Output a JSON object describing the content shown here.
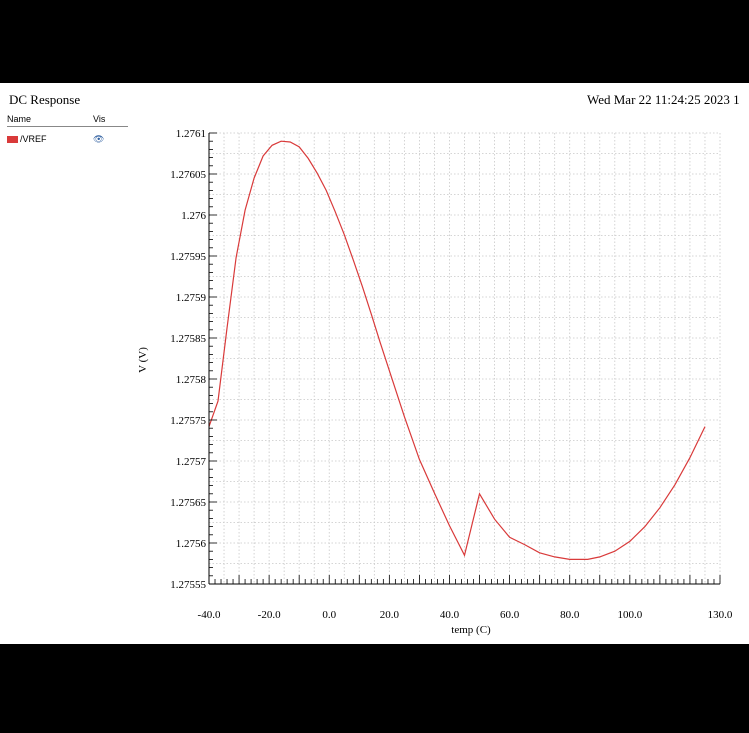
{
  "header": {
    "title": "DC Response",
    "timestamp": "Wed Mar 22 11:24:25 2023  1"
  },
  "legend": {
    "name_header": "Name",
    "vis_header": "Vis",
    "signals": [
      {
        "name": "/VREF",
        "color": "#d93a3a",
        "visible": true,
        "vis_icon": "eye-icon"
      }
    ]
  },
  "chart_data": {
    "type": "line",
    "xlabel": "temp (C)",
    "ylabel": "V (V)",
    "xlim": [
      -40,
      130
    ],
    "ylim": [
      1.27555,
      1.2761
    ],
    "x_ticks": [
      {
        "value": -40,
        "label": "-40.0"
      },
      {
        "value": -20,
        "label": "-20.0"
      },
      {
        "value": 0,
        "label": "0.0"
      },
      {
        "value": 20,
        "label": "20.0"
      },
      {
        "value": 40,
        "label": "40.0"
      },
      {
        "value": 60,
        "label": "60.0"
      },
      {
        "value": 80,
        "label": "80.0"
      },
      {
        "value": 100,
        "label": "100.0"
      },
      {
        "value": 130,
        "label": "130.0"
      }
    ],
    "y_ticks": [
      {
        "value": 1.2761,
        "label": "1.2761"
      },
      {
        "value": 1.27605,
        "label": "1.27605"
      },
      {
        "value": 1.276,
        "label": "1.276"
      },
      {
        "value": 1.27595,
        "label": "1.27595"
      },
      {
        "value": 1.2759,
        "label": "1.2759"
      },
      {
        "value": 1.27585,
        "label": "1.27585"
      },
      {
        "value": 1.2758,
        "label": "1.2758"
      },
      {
        "value": 1.27575,
        "label": "1.27575"
      },
      {
        "value": 1.2757,
        "label": "1.2757"
      },
      {
        "value": 1.27565,
        "label": "1.27565"
      },
      {
        "value": 1.2756,
        "label": "1.2756"
      },
      {
        "value": 1.27555,
        "label": "1.27555"
      }
    ],
    "grid": true,
    "series": [
      {
        "name": "/VREF",
        "color": "#d93a3a",
        "x": [
          -40,
          -37,
          -34,
          -31,
          -28,
          -25,
          -22,
          -19,
          -16,
          -13,
          -10,
          -7,
          -4,
          -1,
          2,
          5,
          8,
          11,
          14,
          17,
          20,
          25,
          30,
          35,
          40,
          45,
          50,
          55,
          60,
          65,
          70,
          75,
          80,
          83,
          86,
          90,
          95,
          100,
          105,
          110,
          115,
          120,
          125
        ],
        "values": [
          1.275742,
          1.275773,
          1.275862,
          1.275948,
          1.276006,
          1.276045,
          1.276072,
          1.276085,
          1.27609,
          1.276089,
          1.276083,
          1.276069,
          1.276051,
          1.27603,
          1.276004,
          1.275976,
          1.275945,
          1.275913,
          1.275879,
          1.275844,
          1.27581,
          1.275754,
          1.275702,
          1.275661,
          1.275621,
          1.275585,
          1.27566,
          1.275629,
          1.275607,
          1.275598,
          1.275588,
          1.275583,
          1.27558,
          1.27558,
          1.27558,
          1.275583,
          1.27559,
          1.275602,
          1.27562,
          1.275643,
          1.275671,
          1.275704,
          1.275742
        ]
      }
    ]
  }
}
